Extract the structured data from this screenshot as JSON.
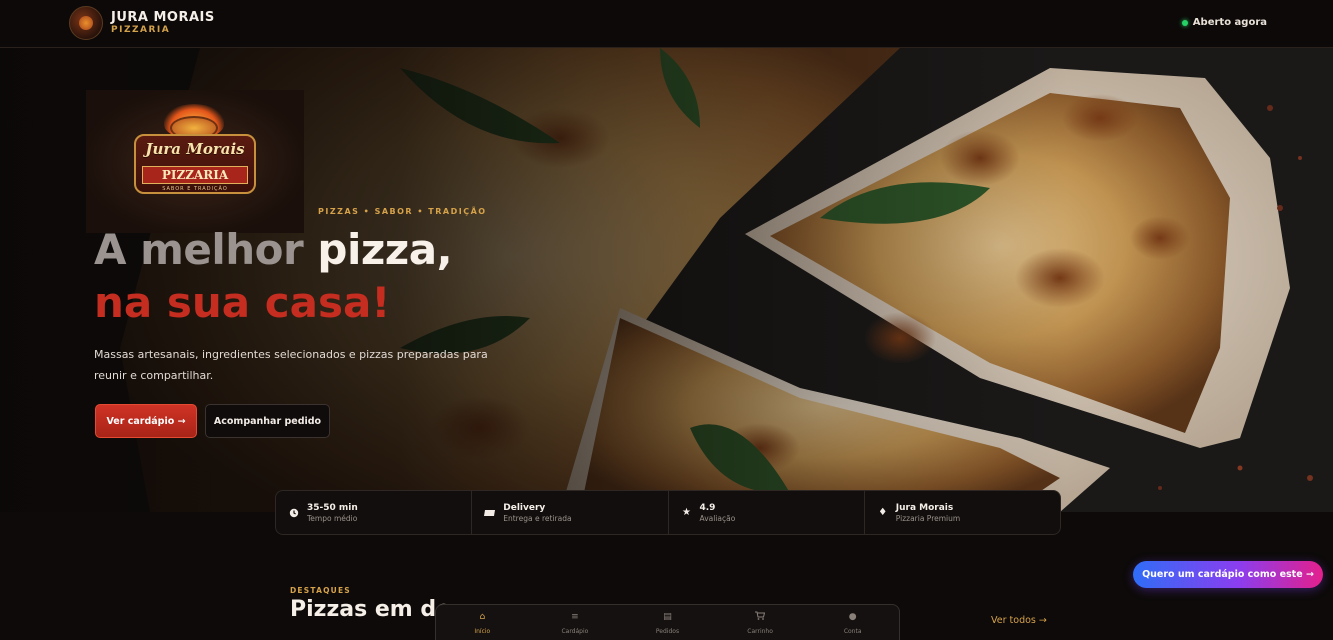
{
  "header": {
    "brand_name": "JURA MORAIS",
    "brand_sub": "PIZZARIA",
    "status_label": "Aberto agora",
    "status_color": "#27d166"
  },
  "hero": {
    "logo": {
      "title": "Jura Morais",
      "ribbon": "PIZZARIA",
      "tagline": "SABOR E TRADIÇÃO"
    },
    "eyebrow": "PIZZAS • SABOR • TRADIÇÃO",
    "headline_part1": "A melhor ",
    "headline_part2": "pizza,",
    "headline_line2": "na sua casa!",
    "lead": "Massas artesanais, ingredientes selecionados e pizzas preparadas para reunir e compartilhar.",
    "primary_button": "Ver cardápio →",
    "secondary_button": "Acompanhar pedido"
  },
  "stats": [
    {
      "icon": "clock-icon",
      "value": "35-50 min",
      "label": "Tempo médio"
    },
    {
      "icon": "delivery-icon",
      "value": "Delivery",
      "label": "Entrega e retirada"
    },
    {
      "icon": "star-icon",
      "value": "4.9",
      "label": "Avaliação"
    },
    {
      "icon": "diamond-icon",
      "value": "Jura Morais",
      "label": "Pizzaria Premium"
    }
  ],
  "featured": {
    "eyebrow": "DESTAQUES",
    "title": "Pizzas em de",
    "see_all": "Ver todos →"
  },
  "tabbar": [
    {
      "icon": "home-icon",
      "label": "Início",
      "active": true
    },
    {
      "icon": "menu-icon",
      "label": "Cardápio",
      "active": false
    },
    {
      "icon": "orders-icon",
      "label": "Pedidos",
      "active": false
    },
    {
      "icon": "cart-icon",
      "label": "Carrinho",
      "active": false
    },
    {
      "icon": "account-icon",
      "label": "Conta",
      "active": false
    }
  ],
  "fab_label": "Quero um cardápio como este →",
  "colors": {
    "accent_red": "#c42d1f",
    "accent_gold": "#d6a24a",
    "background": "#0d0a09"
  }
}
